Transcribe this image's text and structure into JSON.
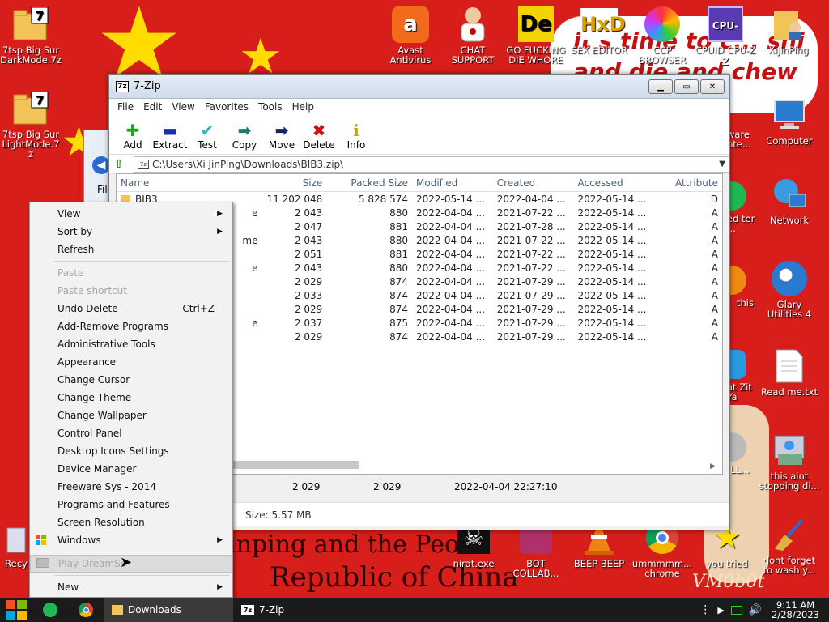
{
  "desktop": {
    "icons_left": [
      {
        "label": "7tsp Big Sur DarkMode.7z",
        "icon": "7z-archive-icon"
      },
      {
        "label": "7tsp Big Sur LightMode.7z",
        "icon": "7z-archive-icon"
      }
    ],
    "icons_top": [
      {
        "label": "Avast Antivirus",
        "icon": "avast-icon"
      },
      {
        "label": "CHAT SUPPORT",
        "icon": "doctor-icon"
      },
      {
        "label": "GO FUCKING DIE WHORE",
        "icon": "de-icon"
      },
      {
        "label": "SEX EDITOR",
        "icon": "hxd-icon"
      },
      {
        "label": "CCP BROWSER",
        "icon": "browser-icon"
      },
      {
        "label": "CPUID CPU-Z",
        "icon": "cpuz-icon"
      },
      {
        "label": "XiJinPing",
        "icon": "user-folder-icon"
      }
    ],
    "icons_right": [
      {
        "label": "Computer",
        "icon": "computer-icon"
      },
      {
        "label": "Network",
        "icon": "network-icon"
      },
      {
        "label": "Glary Utilities 4",
        "icon": "glary-icon"
      },
      {
        "label": "Read me.txt",
        "icon": "text-file-icon"
      },
      {
        "label": "this aint stopping di...",
        "icon": "installer-icon"
      },
      {
        "label": "dont forget to wash y...",
        "icon": "broom-icon"
      }
    ],
    "icons_partial_right": [
      {
        "label": "ware pte..."
      },
      {
        "label": "ed ter ..."
      },
      {
        "label": "this"
      },
      {
        "label": "at Zit Ya"
      },
      {
        "label": "LL..."
      },
      {
        "label": "you tried"
      }
    ],
    "icons_bottom": [
      {
        "label": "Recy",
        "icon": "recycle-bin-icon"
      },
      {
        "label": "nirat.exe",
        "icon": "skull-icon"
      },
      {
        "label": "BOT COLLAB...",
        "icon": "bot-icon"
      },
      {
        "label": "BEEP BEEP",
        "icon": "cone-icon"
      },
      {
        "label": "ummmmm... chrome",
        "icon": "chrome-icon"
      }
    ],
    "wallpaper_texts": {
      "bubble_line1": "it's time to c... shi",
      "bubble_line2": "and die and chew",
      "bottom_line1": "inping and the Peo",
      "bottom_line2": "Republic of China",
      "signature": "VM0b0t"
    }
  },
  "zip_window": {
    "title": "7-Zip",
    "app_icon": "7z",
    "menu": [
      "File",
      "Edit",
      "View",
      "Favorites",
      "Tools",
      "Help"
    ],
    "toolbar": [
      {
        "label": "Add",
        "icon": "plus-icon",
        "glyph": "✚",
        "color": "#1fa51f"
      },
      {
        "label": "Extract",
        "icon": "minus-icon",
        "glyph": "▬",
        "color": "#1b2fa8"
      },
      {
        "label": "Test",
        "icon": "check-icon",
        "glyph": "✔",
        "color": "#2fb0c0"
      },
      {
        "label": "Copy",
        "icon": "copy-arrow-icon",
        "glyph": "➡",
        "color": "#1f7a6a"
      },
      {
        "label": "Move",
        "icon": "move-arrow-icon",
        "glyph": "➡",
        "color": "#12206e"
      },
      {
        "label": "Delete",
        "icon": "delete-x-icon",
        "glyph": "✖",
        "color": "#d01010"
      },
      {
        "label": "Info",
        "icon": "info-icon",
        "glyph": "i",
        "color": "#c7a300"
      }
    ],
    "address": "C:\\Users\\Xi JinPing\\Downloads\\BIB3.zip\\",
    "columns": [
      "Name",
      "Size",
      "Packed Size",
      "Modified",
      "Created",
      "Accessed",
      "Attribute"
    ],
    "rows": [
      {
        "name": "BIB3",
        "size": "11 202 048",
        "packed": "5 828 574",
        "modified": "2022-05-14 ...",
        "created": "2022-04-04 ...",
        "accessed": "2022-05-14 ...",
        "attr": "D"
      },
      {
        "name": "e",
        "size": "2 043",
        "packed": "880",
        "modified": "2022-04-04 ...",
        "created": "2021-07-22 ...",
        "accessed": "2022-05-14 ...",
        "attr": "A"
      },
      {
        "name": "",
        "size": "2 047",
        "packed": "881",
        "modified": "2022-04-04 ...",
        "created": "2021-07-28 ...",
        "accessed": "2022-05-14 ...",
        "attr": "A"
      },
      {
        "name": "me",
        "size": "2 043",
        "packed": "880",
        "modified": "2022-04-04 ...",
        "created": "2021-07-22 ...",
        "accessed": "2022-05-14 ...",
        "attr": "A"
      },
      {
        "name": "",
        "size": "2 051",
        "packed": "881",
        "modified": "2022-04-04 ...",
        "created": "2021-07-22 ...",
        "accessed": "2022-05-14 ...",
        "attr": "A"
      },
      {
        "name": "e",
        "size": "2 043",
        "packed": "880",
        "modified": "2022-04-04 ...",
        "created": "2021-07-22 ...",
        "accessed": "2022-05-14 ...",
        "attr": "A"
      },
      {
        "name": "",
        "size": "2 029",
        "packed": "874",
        "modified": "2022-04-04 ...",
        "created": "2021-07-29 ...",
        "accessed": "2022-05-14 ...",
        "attr": "A"
      },
      {
        "name": "",
        "size": "2 033",
        "packed": "874",
        "modified": "2022-04-04 ...",
        "created": "2021-07-29 ...",
        "accessed": "2022-05-14 ...",
        "attr": "A"
      },
      {
        "name": "",
        "size": "2 029",
        "packed": "874",
        "modified": "2022-04-04 ...",
        "created": "2021-07-29 ...",
        "accessed": "2022-05-14 ...",
        "attr": "A"
      },
      {
        "name": "e",
        "size": "2 037",
        "packed": "875",
        "modified": "2022-04-04 ...",
        "created": "2021-07-29 ...",
        "accessed": "2022-05-14 ...",
        "attr": "A"
      },
      {
        "name": "",
        "size": "2 029",
        "packed": "874",
        "modified": "2022-04-04 ...",
        "created": "2021-07-29 ...",
        "accessed": "2022-05-14 ...",
        "attr": "A"
      }
    ],
    "status": {
      "size": "2 029",
      "packed": "2 029",
      "modified": "2022-04-04 22:27:10"
    },
    "status_total": "Size: 5.57 MB"
  },
  "explorer_sliver": {
    "label": "Fil"
  },
  "context_menu": [
    {
      "label": "View",
      "submenu": true
    },
    {
      "label": "Sort by",
      "submenu": true
    },
    {
      "label": "Refresh"
    },
    {
      "sep": true
    },
    {
      "label": "Paste",
      "disabled": true
    },
    {
      "label": "Paste shortcut",
      "disabled": true
    },
    {
      "label": "Undo Delete",
      "shortcut": "Ctrl+Z"
    },
    {
      "label": "Add-Remove Programs"
    },
    {
      "label": "Administrative Tools"
    },
    {
      "label": "Appearance"
    },
    {
      "label": "Change Cursor"
    },
    {
      "label": "Change Theme"
    },
    {
      "label": "Change Wallpaper"
    },
    {
      "label": "Control Panel"
    },
    {
      "label": "Desktop Icons Settings"
    },
    {
      "label": "Device Manager"
    },
    {
      "label": "Freeware Sys - 2014"
    },
    {
      "label": "Programs and Features"
    },
    {
      "label": "Screen Resolution"
    },
    {
      "label": "Windows",
      "submenu": true,
      "icon": "windows-flag-icon"
    },
    {
      "sep": true
    },
    {
      "label": "Play DreamSc",
      "disabled": true,
      "hover": true,
      "icon": "dreamscene-icon"
    },
    {
      "sep": true
    },
    {
      "label": "New",
      "submenu": true
    }
  ],
  "taskbar": {
    "tasks": [
      {
        "label": "Downloads",
        "icon": "folder-icon",
        "active": true
      },
      {
        "label": "7-Zip",
        "icon": "7z-app-icon",
        "active": false
      }
    ],
    "time": "9:11 AM",
    "date": "2/28/2023"
  }
}
